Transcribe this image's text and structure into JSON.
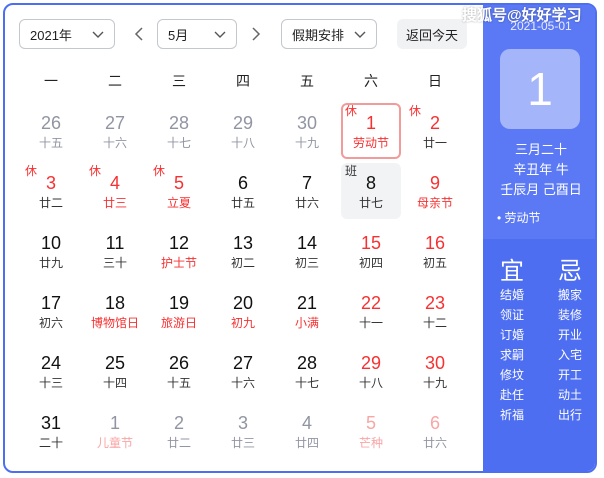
{
  "toolbar": {
    "year": "2021年",
    "month": "5月",
    "holiday_select": "假期安排",
    "today_button": "返回今天"
  },
  "weekdays": [
    "一",
    "二",
    "三",
    "四",
    "五",
    "六",
    "日"
  ],
  "calendar": {
    "rows": [
      [
        {
          "num": "26",
          "sub": "十五",
          "other": true
        },
        {
          "num": "27",
          "sub": "十六",
          "other": true
        },
        {
          "num": "28",
          "sub": "十七",
          "other": true
        },
        {
          "num": "29",
          "sub": "十八",
          "other": true
        },
        {
          "num": "30",
          "sub": "十九",
          "other": true
        },
        {
          "num": "1",
          "sub": "劳动节",
          "badge": "休",
          "red": true,
          "redsub": true,
          "selected": true
        },
        {
          "num": "2",
          "sub": "廿一",
          "badge": "休",
          "red": true
        }
      ],
      [
        {
          "num": "3",
          "sub": "廿二",
          "badge": "休",
          "red": true
        },
        {
          "num": "4",
          "sub": "廿三",
          "badge": "休",
          "red": true,
          "redsub": true
        },
        {
          "num": "5",
          "sub": "立夏",
          "badge": "休",
          "red": true,
          "redsub": true
        },
        {
          "num": "6",
          "sub": "廿五"
        },
        {
          "num": "7",
          "sub": "廿六"
        },
        {
          "num": "8",
          "sub": "廿七",
          "badge": "班",
          "work": true
        },
        {
          "num": "9",
          "sub": "母亲节",
          "red": true,
          "redsub": true
        }
      ],
      [
        {
          "num": "10",
          "sub": "廿九"
        },
        {
          "num": "11",
          "sub": "三十"
        },
        {
          "num": "12",
          "sub": "护士节",
          "redsub": true
        },
        {
          "num": "13",
          "sub": "初二"
        },
        {
          "num": "14",
          "sub": "初三"
        },
        {
          "num": "15",
          "sub": "初四",
          "red": true
        },
        {
          "num": "16",
          "sub": "初五",
          "red": true
        }
      ],
      [
        {
          "num": "17",
          "sub": "初六"
        },
        {
          "num": "18",
          "sub": "博物馆日",
          "redsub": true
        },
        {
          "num": "19",
          "sub": "旅游日",
          "redsub": true
        },
        {
          "num": "20",
          "sub": "初九",
          "redsub": true
        },
        {
          "num": "21",
          "sub": "小满",
          "redsub": true
        },
        {
          "num": "22",
          "sub": "十一",
          "red": true
        },
        {
          "num": "23",
          "sub": "十二",
          "red": true
        }
      ],
      [
        {
          "num": "24",
          "sub": "十三"
        },
        {
          "num": "25",
          "sub": "十四"
        },
        {
          "num": "26",
          "sub": "十五"
        },
        {
          "num": "27",
          "sub": "十六"
        },
        {
          "num": "28",
          "sub": "十七"
        },
        {
          "num": "29",
          "sub": "十八",
          "red": true
        },
        {
          "num": "30",
          "sub": "十九",
          "red": true
        }
      ],
      [
        {
          "num": "31",
          "sub": "二十"
        },
        {
          "num": "1",
          "sub": "儿童节",
          "other": true,
          "redsub": true
        },
        {
          "num": "2",
          "sub": "廿二",
          "other": true
        },
        {
          "num": "3",
          "sub": "廿三",
          "other": true
        },
        {
          "num": "4",
          "sub": "廿四",
          "other": true
        },
        {
          "num": "5",
          "sub": "芒种",
          "other": true,
          "red": true,
          "redsub": true
        },
        {
          "num": "6",
          "sub": "廿六",
          "other": true,
          "red": true
        }
      ]
    ]
  },
  "side": {
    "date": "2021-05-01",
    "day": "1",
    "lunar": "三月二十",
    "ganzhi_year": "辛丑年 牛",
    "ganzhi_daymonth": "壬辰月 己酉日",
    "festival": "• 劳动节",
    "yi_label": "宜",
    "ji_label": "忌",
    "yi": [
      "结婚",
      "领证",
      "订婚",
      "求嗣",
      "修坟",
      "赴任",
      "祈福"
    ],
    "ji": [
      "搬家",
      "装修",
      "开业",
      "入宅",
      "开工",
      "动土",
      "出行"
    ]
  },
  "watermark": "搜狐号@好好学习",
  "colors": {
    "accent": "#4e6ef2",
    "holiday_red": "#f73131",
    "panel_top": "#5b79f4"
  }
}
